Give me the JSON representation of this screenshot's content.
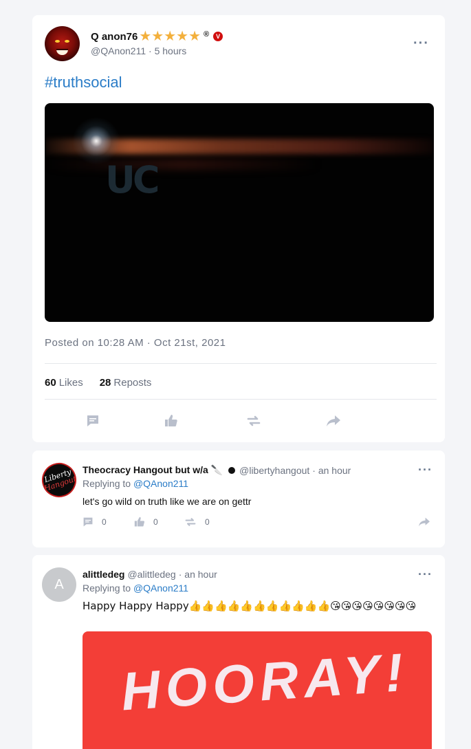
{
  "post": {
    "display_name": "Q anon76",
    "stars": "★★★★★",
    "registered_mark": "®",
    "verified_badge": "V",
    "handle": "@QAnon211",
    "time_ago": "· 5 hours",
    "more": "···",
    "hashtag": "#truthsocial",
    "posted_on": "Posted on 10:28 AM · Oct 21st, 2021",
    "likes_count": "60",
    "likes_label": "Likes",
    "reposts_count": "28",
    "reposts_label": "Reposts",
    "icons": [
      "comment-icon",
      "like-icon",
      "repost-icon",
      "share-icon"
    ]
  },
  "replies": [
    {
      "display_name": "Theocracy Hangout but w/a 🔪",
      "handle": "@libertyhangout",
      "time_ago": "· an hour",
      "replying_prefix": "Replying to",
      "replying_to": "@QAnon211",
      "text": "let's go wild on truth like we are on gettr",
      "comment_count": "0",
      "like_count": "0",
      "repost_count": "0",
      "avatar_text": "Liberty Hangout",
      "avatar_word1": "Liberty",
      "avatar_word2": "Hangout",
      "more": "···"
    },
    {
      "display_name": "alittledeg",
      "handle": "@alittledeg",
      "time_ago": "· an hour",
      "replying_prefix": "Replying to",
      "replying_to": "@QAnon211",
      "text": "Happy Happy Happy👍👍👍👍👍👍👍👍👍👍👍😘😘😘😘😘😘😘😘",
      "avatar_letter": "A",
      "image_text": "HOORAY!",
      "more": "···"
    }
  ],
  "colors": {
    "accent": "#2a7cc7",
    "star": "#f3b03c",
    "verified": "#d10f0f",
    "hooray_bg": "#f33e37",
    "icon_gray": "#b9bfcc"
  }
}
